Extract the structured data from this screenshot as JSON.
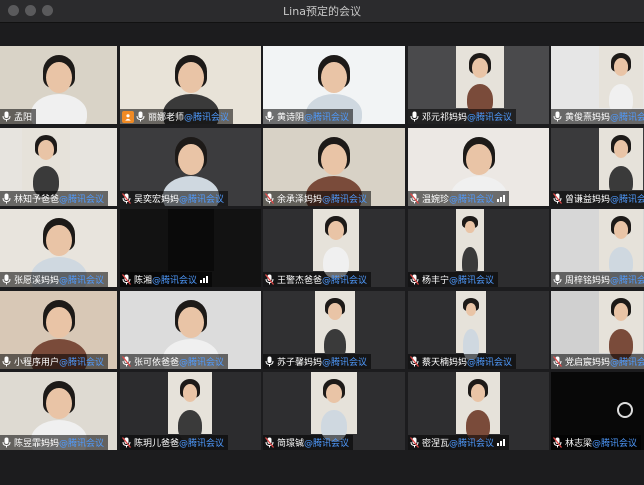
{
  "window": {
    "title": "Lina预定的会议"
  },
  "org_suffix": "@腾讯会议",
  "participants": [
    {
      "name": "孟阳",
      "org": "",
      "signal": false,
      "muted": false
    },
    {
      "name": "丽娜老师",
      "org": "@腾讯会议",
      "signal": false,
      "muted": false,
      "host": true
    },
    {
      "name": "黄诗阴",
      "org": "@腾讯会议",
      "signal": false,
      "muted": false,
      "active": true
    },
    {
      "name": "邓元祁妈妈",
      "org": "@腾讯会议",
      "signal": false,
      "muted": false
    },
    {
      "name": "黄俊熹妈妈",
      "org": "@腾讯会议",
      "signal": false,
      "muted": false
    },
    {
      "name": "林知予爸爸",
      "org": "@腾讯会议",
      "signal": false,
      "muted": false
    },
    {
      "name": "吴奕宏妈妈",
      "org": "@腾讯会议",
      "signal": false,
      "muted": true
    },
    {
      "name": "余承泽妈妈",
      "org": "@腾讯会议",
      "signal": false,
      "muted": true
    },
    {
      "name": "温婉珍",
      "org": "@腾讯会议",
      "signal": true,
      "muted": true
    },
    {
      "name": "曾谦益妈妈",
      "org": "@腾讯会议",
      "signal": false,
      "muted": true
    },
    {
      "name": "张愿溪妈妈",
      "org": "@腾讯会议",
      "signal": false,
      "muted": false
    },
    {
      "name": "陈湘",
      "org": "@腾讯会议",
      "signal": true,
      "muted": true
    },
    {
      "name": "王警杰爸爸",
      "org": "@腾讯会议",
      "signal": false,
      "muted": true
    },
    {
      "name": "杨丰宁",
      "org": "@腾讯会议",
      "signal": false,
      "muted": true
    },
    {
      "name": "周梓铭妈妈",
      "org": "@腾讯会议",
      "signal": false,
      "muted": false
    },
    {
      "name": "小程序用户",
      "org": "@腾讯会议",
      "signal": false,
      "muted": false
    },
    {
      "name": "张可依爸爸",
      "org": "@腾讯会议",
      "signal": false,
      "muted": true
    },
    {
      "name": "苏子馨妈妈",
      "org": "@腾讯会议",
      "signal": false,
      "muted": false
    },
    {
      "name": "蔡天楠妈妈",
      "org": "@腾讯会议",
      "signal": false,
      "muted": true
    },
    {
      "name": "党启宸妈妈",
      "org": "@腾讯会议",
      "signal": false,
      "muted": true
    },
    {
      "name": "陈昱霏妈妈",
      "org": "@腾讯会议",
      "signal": false,
      "muted": false
    },
    {
      "name": "陈玥儿爸爸",
      "org": "@腾讯会议",
      "signal": false,
      "muted": true
    },
    {
      "name": "简璟铖",
      "org": "@腾讯会议",
      "signal": false,
      "muted": true
    },
    {
      "name": "密涅瓦",
      "org": "@腾讯会议",
      "signal": true,
      "muted": true
    },
    {
      "name": "林志梁",
      "org": "@腾讯会议",
      "signal": false,
      "muted": true
    }
  ],
  "colors": {
    "active_border": "#2fb35b",
    "org_text": "#4f9bff",
    "host_badge": "#f08a24"
  }
}
